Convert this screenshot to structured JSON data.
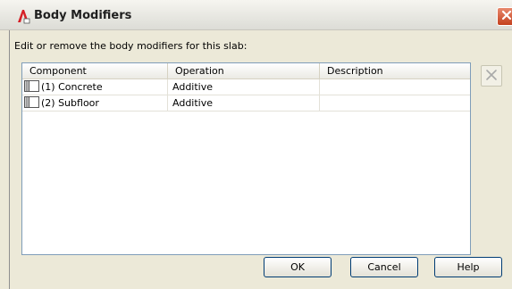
{
  "window": {
    "title": "Body Modifiers",
    "prompt": "Edit or remove the body modifiers for this slab:"
  },
  "table": {
    "columns": [
      "Component",
      "Operation",
      "Description"
    ],
    "rows": [
      {
        "component": "(1) Concrete",
        "operation": "Additive",
        "description": ""
      },
      {
        "component": "(2) Subfloor",
        "operation": "Additive",
        "description": ""
      }
    ]
  },
  "buttons": {
    "ok": "OK",
    "cancel": "Cancel",
    "help": "Help"
  },
  "icons": {
    "app": "autocad-a-icon",
    "close": "close-icon",
    "remove": "remove-x-icon",
    "row": "component-grid-icon"
  },
  "colors": {
    "app_icon": "#d61f26",
    "close_button": "#c4401e",
    "table_border": "#7f9db9",
    "dialog_bg": "#ece9d8"
  }
}
